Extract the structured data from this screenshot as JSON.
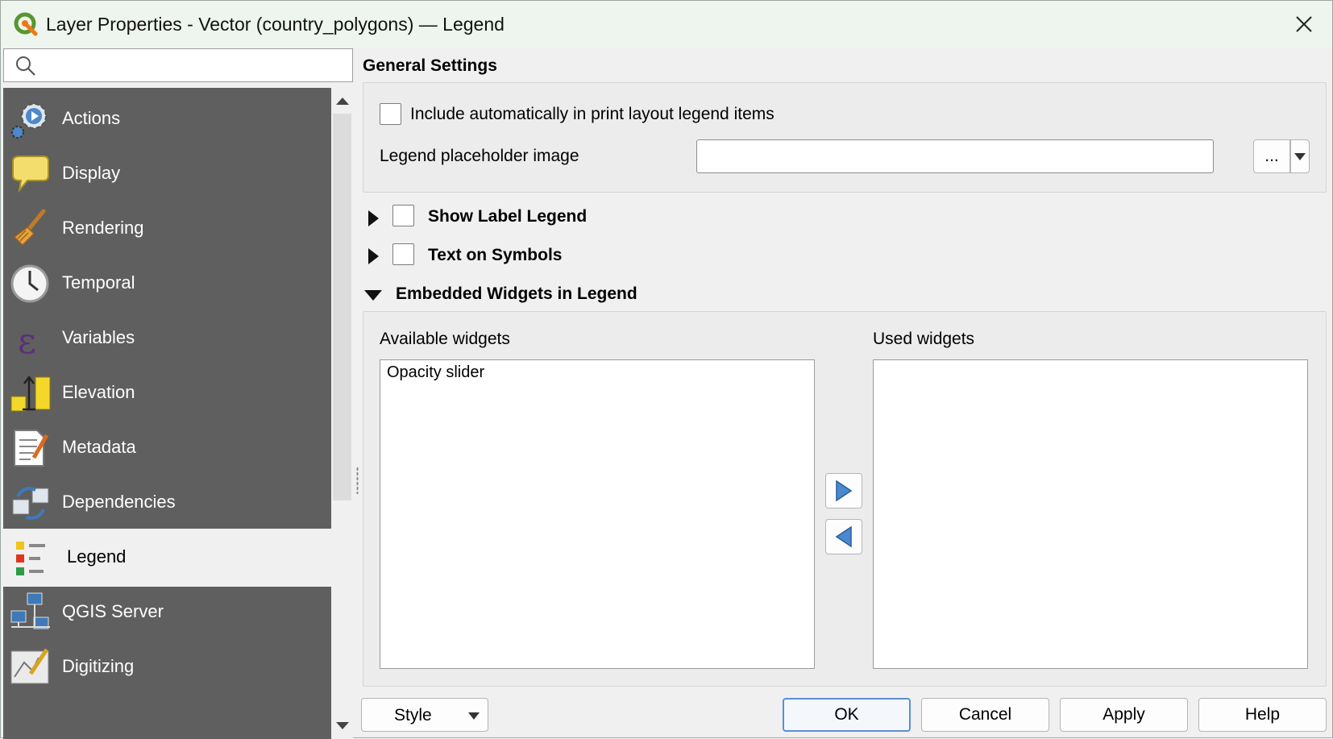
{
  "window": {
    "title": "Layer Properties - Vector (country_polygons) — Legend",
    "accent": "#5b8fd2"
  },
  "search": {
    "placeholder": "",
    "value": ""
  },
  "sidebar": {
    "items": [
      {
        "label": "Actions",
        "icon": "actions-gear-icon"
      },
      {
        "label": "Display",
        "icon": "speech-bubble-icon"
      },
      {
        "label": "Rendering",
        "icon": "paintbrush-icon"
      },
      {
        "label": "Temporal",
        "icon": "clock-icon"
      },
      {
        "label": "Variables",
        "icon": "epsilon-icon"
      },
      {
        "label": "Elevation",
        "icon": "elevation-icon"
      },
      {
        "label": "Metadata",
        "icon": "metadata-document-icon"
      },
      {
        "label": "Dependencies",
        "icon": "dependencies-arrows-icon"
      },
      {
        "label": "Legend",
        "icon": "legend-icon",
        "active": true
      },
      {
        "label": "QGIS Server",
        "icon": "server-network-icon"
      },
      {
        "label": "Digitizing",
        "icon": "digitizing-icon"
      }
    ]
  },
  "general": {
    "title": "General Settings",
    "include_label": "Include automatically in print layout legend items",
    "include_checked": false,
    "placeholder_label": "Legend placeholder image",
    "placeholder_value": "",
    "browse_label": "..."
  },
  "label_legend": {
    "title": "Show Label Legend",
    "checked": false,
    "expanded": false
  },
  "text_symbols": {
    "title": "Text on Symbols",
    "checked": false,
    "expanded": false
  },
  "embedded": {
    "title": "Embedded Widgets in Legend",
    "expanded": true,
    "available_label": "Available widgets",
    "used_label": "Used widgets",
    "available_items": [
      "Opacity slider"
    ],
    "used_items": []
  },
  "buttons": {
    "style": "Style",
    "ok": "OK",
    "cancel": "Cancel",
    "apply": "Apply",
    "help": "Help"
  }
}
